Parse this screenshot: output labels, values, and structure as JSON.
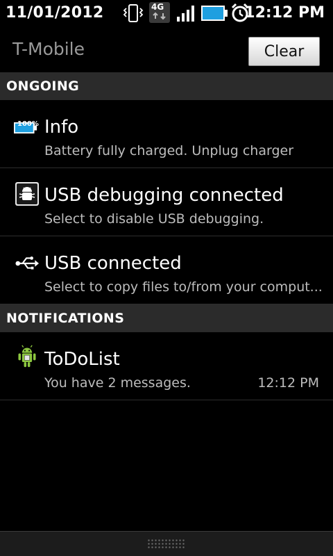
{
  "status_bar": {
    "date": "11/01/2012",
    "time": "12:12 PM",
    "icons": [
      "vibrate-icon",
      "4g-data-icon",
      "signal-icon",
      "battery-icon",
      "alarm-icon"
    ],
    "network_label": "4G"
  },
  "header": {
    "carrier": "T-Mobile",
    "clear_label": "Clear"
  },
  "sections": {
    "ongoing": "ONGOING",
    "notifications": "NOTIFICATIONS"
  },
  "ongoing": [
    {
      "title": "Info",
      "text": "Battery fully charged. Unplug charger",
      "icon": "battery-full-icon",
      "icon_text": "100%"
    },
    {
      "title": "USB debugging connected",
      "text": "Select to disable USB debugging.",
      "icon": "android-debug-icon"
    },
    {
      "title": "USB connected",
      "text": "Select to copy files to/from your comput...",
      "icon": "usb-icon"
    }
  ],
  "notifications": [
    {
      "title": "ToDoList",
      "text": "You have 2 messages.",
      "time": "12:12 PM",
      "icon": "android-app-icon"
    }
  ],
  "colors": {
    "section_bg": "#2b2b2b",
    "battery_blue": "#1e9fe0",
    "android_green": "#8cc63f"
  }
}
